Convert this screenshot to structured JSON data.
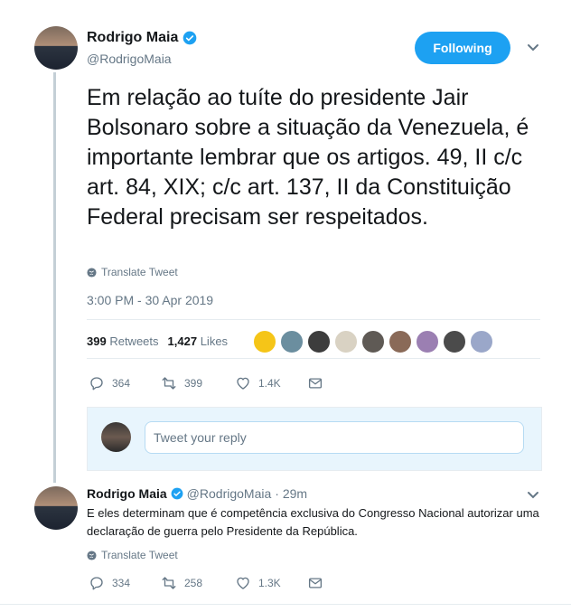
{
  "tweet": {
    "author_name": "Rodrigo Maia",
    "author_handle": "@RodrigoMaia",
    "follow_label": "Following",
    "text": "Em relação ao tuíte do presidente Jair Bolsonaro sobre a situação da Venezuela, é importante lembrar que os artigos. 49, II c/c art. 84, XIX; c/c art. 137, II da Constituição Federal precisam ser respeitados.",
    "translate_label": "Translate Tweet",
    "timestamp": "3:00 PM - 30 Apr 2019",
    "retweets_count": "399",
    "retweets_label": "Retweets",
    "likes_count": "1,427",
    "likes_label": "Likes",
    "actions": {
      "replies": "364",
      "retweets": "399",
      "likes": "1.4K"
    },
    "liker_colors": [
      "#f5c518",
      "#6b8e9f",
      "#3d3d3d",
      "#d9d2c3",
      "#5f5a55",
      "#8a6a58",
      "#9b7fb2",
      "#4b4b4b",
      "#9aa7c9"
    ]
  },
  "reply_box": {
    "placeholder": "Tweet your reply"
  },
  "reply_tweet": {
    "author_name": "Rodrigo Maia",
    "author_handle": "@RodrigoMaia",
    "time_ago": "· 29m",
    "text": "E eles determinam que é competência exclusiva do Congresso Nacional autorizar uma declaração de guerra pelo Presidente da República.",
    "translate_label": "Translate Tweet",
    "actions": {
      "replies": "334",
      "retweets": "258",
      "likes": "1.3K"
    }
  },
  "colors": {
    "accent": "#1da1f2",
    "muted": "#657786",
    "text": "#14171a"
  }
}
